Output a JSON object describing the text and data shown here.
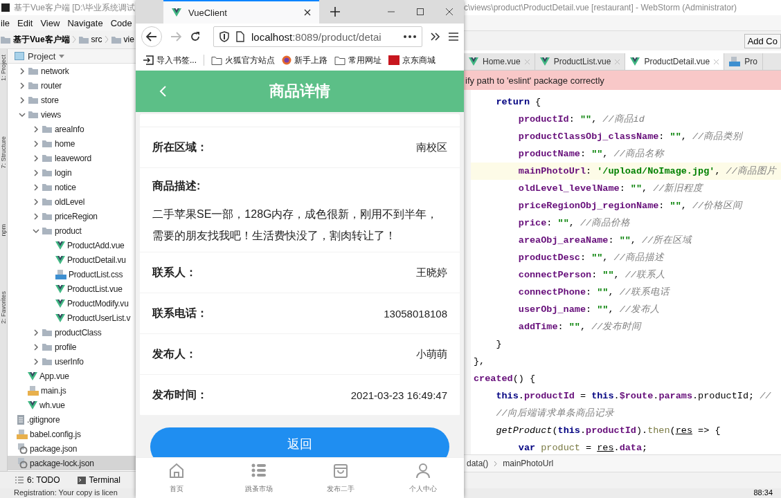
{
  "ide_left": {
    "title": "基于Vue客户端 [D:\\毕业系统调试",
    "menu": [
      "ile",
      "Edit",
      "View",
      "Navigate",
      "Code"
    ],
    "breadcrumb": [
      {
        "label": "基于Vue客户端",
        "bold": true
      },
      {
        "label": "src",
        "bold": false
      },
      {
        "label": "vie",
        "bold": false
      }
    ],
    "side_tabs": [
      "1: Project",
      "7: Structure",
      "npm",
      "2: Favorites"
    ],
    "project_header": "Project",
    "tree": [
      {
        "kind": "folder",
        "label": "network",
        "expanded": false,
        "selected": false
      },
      {
        "kind": "folder",
        "label": "router",
        "expanded": false,
        "selected": false
      },
      {
        "kind": "folder",
        "label": "store",
        "expanded": false,
        "selected": false
      },
      {
        "kind": "folder",
        "label": "views",
        "expanded": true,
        "selected": false,
        "children": [
          {
            "kind": "folder",
            "label": "areaInfo",
            "expanded": false,
            "selected": false
          },
          {
            "kind": "folder",
            "label": "home",
            "expanded": false,
            "selected": false
          },
          {
            "kind": "folder",
            "label": "leaveword",
            "expanded": false,
            "selected": false
          },
          {
            "kind": "folder",
            "label": "login",
            "expanded": false,
            "selected": false
          },
          {
            "kind": "folder",
            "label": "notice",
            "expanded": false,
            "selected": false
          },
          {
            "kind": "folder",
            "label": "oldLevel",
            "expanded": false,
            "selected": false
          },
          {
            "kind": "folder",
            "label": "priceRegion",
            "expanded": false,
            "selected": false
          },
          {
            "kind": "folder",
            "label": "product",
            "expanded": true,
            "selected": false,
            "children": [
              {
                "kind": "vue",
                "label": "ProductAdd.vue",
                "selected": false
              },
              {
                "kind": "vue",
                "label": "ProductDetail.vu",
                "selected": false
              },
              {
                "kind": "css",
                "label": "ProductList.css",
                "selected": false
              },
              {
                "kind": "vue",
                "label": "ProductList.vue",
                "selected": false
              },
              {
                "kind": "vue",
                "label": "ProductModify.vu",
                "selected": false
              },
              {
                "kind": "vue",
                "label": "ProductUserList.v",
                "selected": false
              }
            ]
          },
          {
            "kind": "folder",
            "label": "productClass",
            "expanded": false,
            "selected": false
          },
          {
            "kind": "folder",
            "label": "profile",
            "expanded": false,
            "selected": false
          },
          {
            "kind": "folder",
            "label": "userInfo",
            "expanded": false,
            "selected": false
          }
        ]
      },
      {
        "kind": "vue",
        "label": "App.vue",
        "selected": false
      },
      {
        "kind": "js",
        "label": "main.js",
        "selected": false
      },
      {
        "kind": "vue",
        "label": "wh.vue",
        "selected": false
      }
    ],
    "root_files": [
      {
        "kind": "text",
        "label": ".gitignore",
        "selected": false
      },
      {
        "kind": "js",
        "label": "babel.config.js",
        "selected": false
      },
      {
        "kind": "json",
        "label": "package.json",
        "selected": false
      },
      {
        "kind": "json",
        "label": "package-lock.json",
        "selected": true
      }
    ],
    "bottom_tabs": [
      "6: TODO",
      "Terminal"
    ],
    "status": "Registration: Your copy is licen"
  },
  "browser": {
    "tab_title": "VueClient",
    "url_host": "localhost",
    "url_rest": ":8089/product/detai",
    "bookmarks": [
      {
        "kind": "import",
        "label": "导入书签..."
      },
      {
        "kind": "folder",
        "label": "火狐官方站点"
      },
      {
        "kind": "firefox",
        "label": "新手上路"
      },
      {
        "kind": "folder",
        "label": "常用网址"
      },
      {
        "kind": "jd",
        "label": "京东商城"
      }
    ]
  },
  "app": {
    "header_title": "商品详情",
    "rows": [
      {
        "kind": "pair",
        "label": "所在区域：",
        "value": "南校区"
      },
      {
        "kind": "block",
        "label": "商品描述:",
        "value": "二手苹果SE一部，128G内存，成色很新，刚用不到半年，需要的朋友找我吧！生活费快没了，割肉转让了！"
      },
      {
        "kind": "pair",
        "label": "联系人：",
        "value": "王晓婷"
      },
      {
        "kind": "pair",
        "label": "联系电话：",
        "value": "13058018108"
      },
      {
        "kind": "pair",
        "label": "发布人：",
        "value": "小萌萌"
      },
      {
        "kind": "pair",
        "label": "发布时间：",
        "value": "2021-03-23 16:49:47"
      }
    ],
    "back_button": "返回",
    "tabbar": [
      {
        "kind": "home",
        "label": "首页"
      },
      {
        "kind": "list",
        "label": "跳蚤市场"
      },
      {
        "kind": "bag",
        "label": "发布二手"
      },
      {
        "kind": "user",
        "label": "个人中心"
      }
    ]
  },
  "editor": {
    "title": "c\\views\\product\\ProductDetail.vue [restaurant] - WebStorm (Administrator)",
    "toolbar_button": "Add Co",
    "tabs": [
      {
        "kind": "vue",
        "label": "Home.vue",
        "selected": false
      },
      {
        "kind": "vue",
        "label": "ProductList.vue",
        "selected": false
      },
      {
        "kind": "vue",
        "label": "ProductDetail.vue",
        "selected": true
      },
      {
        "kind": "css",
        "label": "Pro",
        "selected": false
      }
    ],
    "banner": "ify path to 'eslint' package correctly",
    "lines": [
      {
        "current": false,
        "tokens": [
          {
            "kind": "keyword",
            "text": "    return"
          },
          {
            "kind": "plain",
            "text": " {"
          }
        ]
      },
      {
        "current": false,
        "tokens": [
          {
            "kind": "field",
            "text": "        productId"
          },
          {
            "kind": "plain",
            "text": ": "
          },
          {
            "kind": "string",
            "text": "\"\""
          },
          {
            "kind": "plain",
            "text": ", "
          },
          {
            "kind": "comment",
            "text": "//商品id"
          }
        ]
      },
      {
        "current": false,
        "tokens": [
          {
            "kind": "field",
            "text": "        productClassObj_className"
          },
          {
            "kind": "plain",
            "text": ": "
          },
          {
            "kind": "string",
            "text": "\"\""
          },
          {
            "kind": "plain",
            "text": ", "
          },
          {
            "kind": "comment",
            "text": "//商品类别"
          }
        ]
      },
      {
        "current": false,
        "tokens": [
          {
            "kind": "field",
            "text": "        productName"
          },
          {
            "kind": "plain",
            "text": ": "
          },
          {
            "kind": "string",
            "text": "\"\""
          },
          {
            "kind": "plain",
            "text": ", "
          },
          {
            "kind": "comment",
            "text": "//商品名称"
          }
        ]
      },
      {
        "current": true,
        "tokens": [
          {
            "kind": "field",
            "text": "        mainPhotoUrl"
          },
          {
            "kind": "plain",
            "text": ": "
          },
          {
            "kind": "string",
            "text": "'/upload/NoImage.jpg'"
          },
          {
            "kind": "plain",
            "text": ", "
          },
          {
            "kind": "comment",
            "text": "//商品图片"
          }
        ]
      },
      {
        "current": false,
        "tokens": [
          {
            "kind": "field",
            "text": "        oldLevel_levelName"
          },
          {
            "kind": "plain",
            "text": ": "
          },
          {
            "kind": "string",
            "text": "\"\""
          },
          {
            "kind": "plain",
            "text": ", "
          },
          {
            "kind": "comment",
            "text": "//新旧程度"
          }
        ]
      },
      {
        "current": false,
        "tokens": [
          {
            "kind": "field",
            "text": "        priceRegionObj_regionName"
          },
          {
            "kind": "plain",
            "text": ": "
          },
          {
            "kind": "string",
            "text": "\"\""
          },
          {
            "kind": "plain",
            "text": ", "
          },
          {
            "kind": "comment",
            "text": "//价格区间"
          }
        ]
      },
      {
        "current": false,
        "tokens": [
          {
            "kind": "field",
            "text": "        price"
          },
          {
            "kind": "plain",
            "text": ": "
          },
          {
            "kind": "string",
            "text": "\"\""
          },
          {
            "kind": "plain",
            "text": ", "
          },
          {
            "kind": "comment",
            "text": "//商品价格"
          }
        ]
      },
      {
        "current": false,
        "tokens": [
          {
            "kind": "field",
            "text": "        areaObj_areaName"
          },
          {
            "kind": "plain",
            "text": ": "
          },
          {
            "kind": "string",
            "text": "\"\""
          },
          {
            "kind": "plain",
            "text": ", "
          },
          {
            "kind": "comment",
            "text": "//所在区域"
          }
        ]
      },
      {
        "current": false,
        "tokens": [
          {
            "kind": "field",
            "text": "        productDesc"
          },
          {
            "kind": "plain",
            "text": ": "
          },
          {
            "kind": "string",
            "text": "\"\""
          },
          {
            "kind": "plain",
            "text": ", "
          },
          {
            "kind": "comment",
            "text": "//商品描述"
          }
        ]
      },
      {
        "current": false,
        "tokens": [
          {
            "kind": "field",
            "text": "        connectPerson"
          },
          {
            "kind": "plain",
            "text": ": "
          },
          {
            "kind": "string",
            "text": "\"\""
          },
          {
            "kind": "plain",
            "text": ", "
          },
          {
            "kind": "comment",
            "text": "//联系人"
          }
        ]
      },
      {
        "current": false,
        "tokens": [
          {
            "kind": "field",
            "text": "        connectPhone"
          },
          {
            "kind": "plain",
            "text": ": "
          },
          {
            "kind": "string",
            "text": "\"\""
          },
          {
            "kind": "plain",
            "text": ", "
          },
          {
            "kind": "comment",
            "text": "//联系电话"
          }
        ]
      },
      {
        "current": false,
        "tokens": [
          {
            "kind": "field",
            "text": "        userObj_name"
          },
          {
            "kind": "plain",
            "text": ": "
          },
          {
            "kind": "string",
            "text": "\"\""
          },
          {
            "kind": "plain",
            "text": ", "
          },
          {
            "kind": "comment",
            "text": "//发布人"
          }
        ]
      },
      {
        "current": false,
        "tokens": [
          {
            "kind": "field",
            "text": "        addTime"
          },
          {
            "kind": "plain",
            "text": ": "
          },
          {
            "kind": "string",
            "text": "\"\""
          },
          {
            "kind": "plain",
            "text": ", "
          },
          {
            "kind": "comment",
            "text": "//发布时间"
          }
        ]
      },
      {
        "current": false,
        "tokens": [
          {
            "kind": "plain",
            "text": "    }"
          }
        ]
      },
      {
        "current": false,
        "tokens": [
          {
            "kind": "plain",
            "text": "},"
          }
        ]
      },
      {
        "current": false,
        "tokens": [
          {
            "kind": "field",
            "text": "created"
          },
          {
            "kind": "plain",
            "text": "() {"
          }
        ]
      },
      {
        "current": false,
        "tokens": [
          {
            "kind": "keyword",
            "text": "    this"
          },
          {
            "kind": "plain",
            "text": "."
          },
          {
            "kind": "field",
            "text": "productId"
          },
          {
            "kind": "plain",
            "text": " = "
          },
          {
            "kind": "keyword",
            "text": "this"
          },
          {
            "kind": "plain",
            "text": "."
          },
          {
            "kind": "field",
            "text": "$route"
          },
          {
            "kind": "plain",
            "text": "."
          },
          {
            "kind": "field",
            "text": "params"
          },
          {
            "kind": "plain",
            "text": ".productId; "
          },
          {
            "kind": "comment",
            "text": "//"
          }
        ]
      },
      {
        "current": false,
        "tokens": [
          {
            "kind": "comment",
            "text": "    //向后端请求单条商品记录"
          }
        ]
      },
      {
        "current": false,
        "tokens": [
          {
            "kind": "call",
            "text": "    getProduct"
          },
          {
            "kind": "plain",
            "text": "("
          },
          {
            "kind": "keyword",
            "text": "this"
          },
          {
            "kind": "plain",
            "text": "."
          },
          {
            "kind": "field",
            "text": "productId"
          },
          {
            "kind": "plain",
            "text": ")."
          },
          {
            "kind": "method",
            "text": "then"
          },
          {
            "kind": "plain",
            "text": "("
          },
          {
            "kind": "param",
            "text": "res"
          },
          {
            "kind": "plain",
            "text": " => {"
          }
        ]
      },
      {
        "current": false,
        "tokens": [
          {
            "kind": "keyword",
            "text": "        var"
          },
          {
            "kind": "method",
            "text": " product"
          },
          {
            "kind": "plain",
            "text": " = "
          },
          {
            "kind": "param",
            "text": "res"
          },
          {
            "kind": "plain",
            "text": "."
          },
          {
            "kind": "field",
            "text": "data"
          },
          {
            "kind": "plain",
            "text": ";"
          }
        ]
      }
    ],
    "breadcrumb": [
      "data()",
      "mainPhotoUrl"
    ],
    "position": "88:34"
  }
}
